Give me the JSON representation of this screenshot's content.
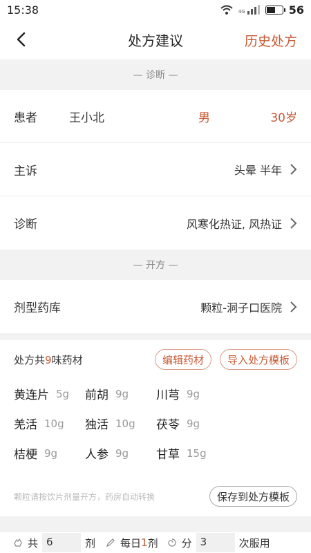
{
  "status": {
    "time": "15:38",
    "network": "4G",
    "battery": "56"
  },
  "nav": {
    "title": "处方建议",
    "history": "历史处方"
  },
  "sections": {
    "diagnosis": "— 诊断 —",
    "prescribe": "— 开方 —"
  },
  "patient": {
    "label": "患者",
    "name": "王小北",
    "gender": "男",
    "age": "30岁"
  },
  "complaint": {
    "label": "主诉",
    "value": "头晕 半年"
  },
  "diagnosis": {
    "label": "诊断",
    "value": "风寒化热证, 风热证"
  },
  "pharmacy": {
    "label": "剂型药库",
    "value": "颗粒-洞子口医院"
  },
  "rx": {
    "prefix": "处方共",
    "count": "9",
    "suffix": "味药材",
    "edit_label": "编辑药材",
    "import_label": "导入处方模板",
    "note": "颗粒请按饮片剂量开方，药房自动转换",
    "save_label": "保存到处方模板",
    "herbs": [
      {
        "name": "黄连片",
        "dose": "5g"
      },
      {
        "name": "前胡",
        "dose": "9g"
      },
      {
        "name": "川芎",
        "dose": "9g"
      },
      {
        "name": "羌活",
        "dose": "10g"
      },
      {
        "name": "独活",
        "dose": "10g"
      },
      {
        "name": "茯苓",
        "dose": "9g"
      },
      {
        "name": "桔梗",
        "dose": "9g"
      },
      {
        "name": "人参",
        "dose": "9g"
      },
      {
        "name": "甘草",
        "dose": "15g"
      }
    ]
  },
  "dose": {
    "total_prefix": "共",
    "total_value": "6",
    "total_unit": "剂",
    "daily_prefix": "每日",
    "daily_value": "1",
    "daily_unit": "剂",
    "split_prefix": "分",
    "split_value": "3",
    "split_unit": "次服用"
  },
  "colors": {
    "accent": "#c65a34",
    "background": "#f2f2f2"
  },
  "icons": [
    "wifi-icon",
    "signal-icon",
    "battery-icon",
    "back-arrow-icon",
    "chevron-right-icon",
    "hand-icon",
    "pen-icon",
    "swirl-icon"
  ]
}
